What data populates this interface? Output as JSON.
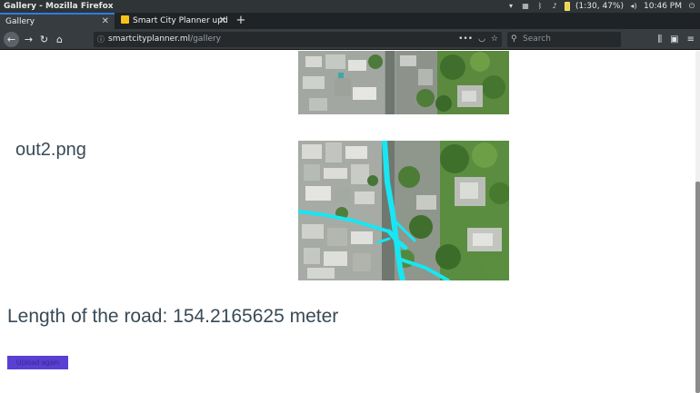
{
  "os_bar": {
    "window_title": "Gallery - Mozilla Firefox",
    "battery_text": "(1:30, 47%)",
    "clock": "10:46 PM"
  },
  "tabs": [
    {
      "label": "Gallery",
      "active": true
    },
    {
      "label": "Smart City Planner upd",
      "active": false
    }
  ],
  "nav": {
    "url_host": "smartcityplanner.ml",
    "url_path": "/gallery",
    "search_placeholder": "Search"
  },
  "content": {
    "image_label": "out2.png",
    "road_length_text": "Length of the road: 154.2165625 meter",
    "upload_button": "Upload again"
  },
  "colors": {
    "road_highlight": "#18e6f2",
    "button_bg": "#5a3fd3",
    "text": "#394a56"
  },
  "icons": [
    "wifi-icon",
    "keyboard-icon",
    "bluetooth-icon",
    "bell-icon",
    "battery-icon",
    "volume-icon",
    "power-icon",
    "back-icon",
    "forward-icon",
    "reload-icon",
    "home-icon",
    "info-icon",
    "more-icon",
    "pocket-icon",
    "bookmark-star-icon",
    "search-icon",
    "library-icon",
    "sidebar-icon",
    "menu-icon"
  ]
}
